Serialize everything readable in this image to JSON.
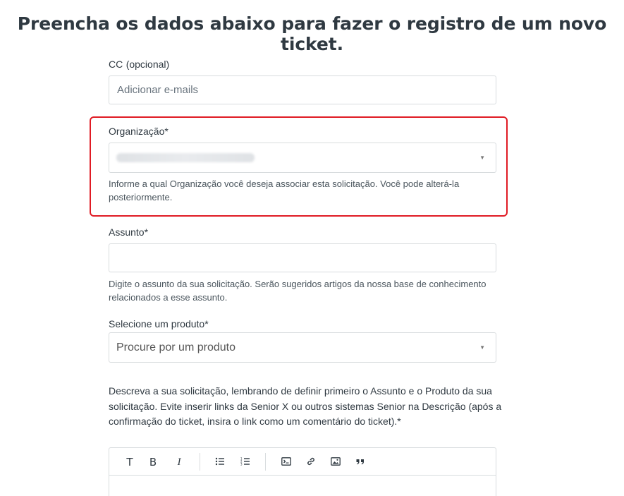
{
  "page": {
    "title": "Preencha os dados abaixo para fazer o registro de um novo ticket."
  },
  "cc": {
    "label": "CC",
    "optional": "(opcional)",
    "placeholder": "Adicionar e-mails"
  },
  "organization": {
    "label": "Organização*",
    "hint": "Informe a qual Organização você deseja associar esta solicitação. Você pode alterá-la posteriormente."
  },
  "subject": {
    "label": "Assunto*",
    "value": "",
    "hint": "Digite o assunto da sua solicitação. Serão sugeridos artigos da nossa base de conhecimento relacionados a esse assunto."
  },
  "product": {
    "label": "Selecione um produto*",
    "placeholder": "Procure por um produto"
  },
  "description": {
    "label": "Descreva a sua solicitação, lembrando de definir primeiro o Assunto e o Produto da sua solicitação. Evite inserir links da Senior X ou outros sistemas Senior na Descrição (após a confirmação do ticket, insira o link como um comentário do ticket).*"
  },
  "toolbar": {
    "text_label": "T",
    "bold_label": "B",
    "italic_label": "I",
    "icons": [
      "text-format-icon",
      "bold-icon",
      "italic-icon",
      "bulleted-list-icon",
      "numbered-list-icon",
      "code-block-icon",
      "link-icon",
      "image-icon",
      "quote-icon"
    ]
  },
  "colors": {
    "highlight": "#e01b24",
    "border": "#d8dcde",
    "text": "#2f3941"
  }
}
